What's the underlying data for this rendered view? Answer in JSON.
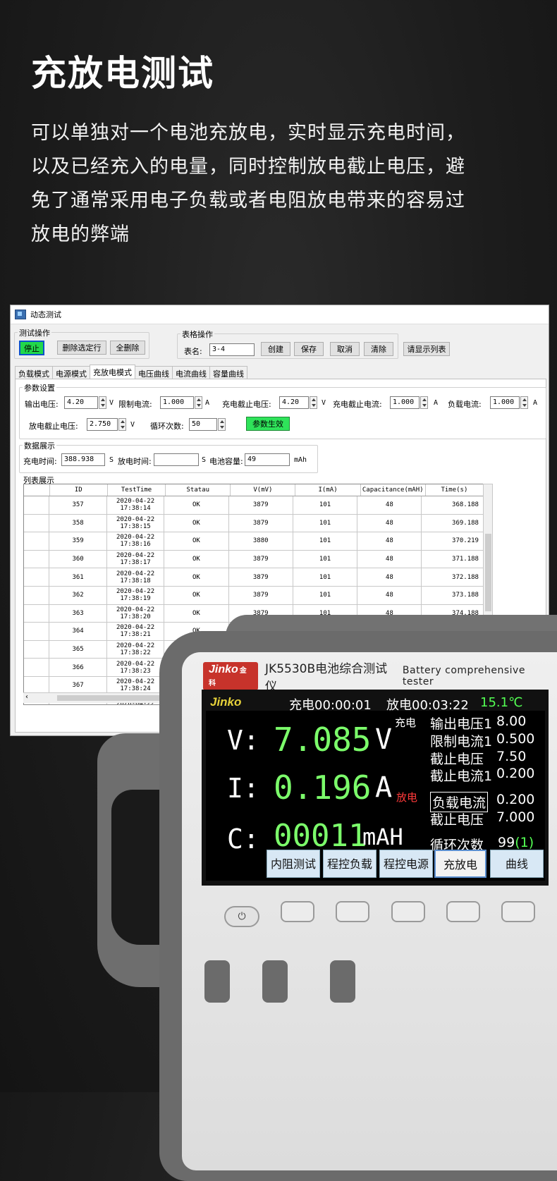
{
  "hero": {
    "title": "充放电测试",
    "lines": [
      "可以单独对一个电池充放电，实时显示充电时间，",
      "以及已经充入的电量，同时控制放电截止电压，避",
      "免了通常采用电子负载或者电阻放电带来的容易过",
      "放电的弊端"
    ]
  },
  "window": {
    "title": "动态测试",
    "test_ops": {
      "label": "测试操作",
      "stop": "停止",
      "delete_selected": "删除选定行",
      "delete_all": "全删除"
    },
    "table_ops": {
      "label": "表格操作",
      "name_label": "表名:",
      "name_value": "3-4",
      "create": "创建",
      "save": "保存",
      "cancel": "取消",
      "clear": "清除",
      "show_list": "请显示列表"
    },
    "tabs": [
      "负载模式",
      "电源模式",
      "充放电模式",
      "电压曲线",
      "电流曲线",
      "容量曲线"
    ],
    "params": {
      "label": "参数设置",
      "output_voltage_label": "输出电压:",
      "output_voltage": "4.20",
      "output_voltage_unit": "V",
      "limit_current_label": "限制电流:",
      "limit_current": "1.000",
      "limit_current_unit": "A",
      "charge_cutoff_v_label": "充电截止电压:",
      "charge_cutoff_v": "4.20",
      "charge_cutoff_v_unit": "V",
      "charge_cutoff_i_label": "充电截止电流:",
      "charge_cutoff_i": "1.000",
      "charge_cutoff_i_unit": "A",
      "load_current_label": "负载电流:",
      "load_current": "1.000",
      "load_current_unit": "A",
      "discharge_cutoff_v_label": "放电截止电压:",
      "discharge_cutoff_v": "2.750",
      "discharge_cutoff_v_unit": "V",
      "cycles_label": "循环次数:",
      "cycles": "50",
      "apply": "参数生效"
    },
    "data_display": {
      "label": "数据展示",
      "charge_time_label": "充电时间:",
      "charge_time": "388.938",
      "charge_time_unit": "S",
      "discharge_time_label": "放电时间:",
      "discharge_time": "",
      "discharge_time_unit": "S",
      "capacity_label": "电池容量:",
      "capacity": "49",
      "capacity_unit": "mAh"
    },
    "list_label": "列表展示",
    "columns": [
      "",
      "ID",
      "TestTime",
      "Statau",
      "V(mV)",
      "I(mA)",
      "Capacitance(mAH)",
      "Time(s)"
    ],
    "rows": [
      [
        "",
        "357",
        "2020-04-22",
        "17:38:14",
        "OK",
        "3879",
        "101",
        "48",
        "368.188"
      ],
      [
        "",
        "358",
        "2020-04-22",
        "17:38:15",
        "OK",
        "3879",
        "101",
        "48",
        "369.188"
      ],
      [
        "",
        "359",
        "2020-04-22",
        "17:38:16",
        "OK",
        "3880",
        "101",
        "48",
        "370.219"
      ],
      [
        "",
        "360",
        "2020-04-22",
        "17:38:17",
        "OK",
        "3879",
        "101",
        "48",
        "371.188"
      ],
      [
        "",
        "361",
        "2020-04-22",
        "17:38:18",
        "OK",
        "3879",
        "101",
        "48",
        "372.188"
      ],
      [
        "",
        "362",
        "2020-04-22",
        "17:38:19",
        "OK",
        "3879",
        "101",
        "48",
        "373.188"
      ],
      [
        "",
        "363",
        "2020-04-22",
        "17:38:20",
        "OK",
        "3879",
        "101",
        "48",
        "374.188"
      ],
      [
        "",
        "364",
        "2020-04-22",
        "17:38:21",
        "OK",
        "",
        "",
        "",
        ""
      ],
      [
        "",
        "365",
        "2020-04-22",
        "17:38:22",
        "",
        "",
        "",
        "",
        ""
      ],
      [
        "",
        "366",
        "2020-04-22",
        "17:38:23",
        "",
        "",
        "",
        "",
        ""
      ],
      [
        "",
        "367",
        "2020-04-22",
        "17:38:24",
        "",
        "",
        "",
        "",
        ""
      ],
      [
        "",
        "",
        "2020-04-22",
        "",
        "",
        "",
        "",
        "",
        ""
      ]
    ]
  },
  "device": {
    "brand": "Jinko",
    "brand_cn": "金科",
    "model": "JK5530B电池综合测试仪",
    "model_en": "Battery comprehensive tester",
    "status": {
      "logo": "Jinko",
      "charge_time": "充电00:00:01",
      "discharge_time": "放电00:03:22",
      "temp": "15.1℃"
    },
    "voltage_label": "V:",
    "voltage": "7.085",
    "voltage_unit": "V",
    "current_label": "I:",
    "current": "0.196",
    "current_unit": "A",
    "capacity_label": "C:",
    "capacity": "00011",
    "capacity_unit": "mAH",
    "charge_tag": "充电",
    "discharge_tag": "放电",
    "params": [
      {
        "label": "输出电压1",
        "value": "8.00"
      },
      {
        "label": "限制电流1",
        "value": "0.500"
      },
      {
        "label": "截止电压",
        "value": "7.50"
      },
      {
        "label": "截止电流1",
        "value": "0.200"
      },
      {
        "label": "负载电流",
        "value": "0.200"
      },
      {
        "label": "截止电压",
        "value": "7.000"
      }
    ],
    "cycles_label": "循环次数",
    "cycles_value": "99",
    "cycles_current": "(1)",
    "softkeys": [
      "内阻测试",
      "程控负载",
      "程控电源",
      "充放电",
      "曲线"
    ],
    "colors": {
      "green": "#7cff6b",
      "red": "#ff3a3a",
      "temp_green": "#53ff53",
      "screen_bg": "#000000"
    }
  }
}
